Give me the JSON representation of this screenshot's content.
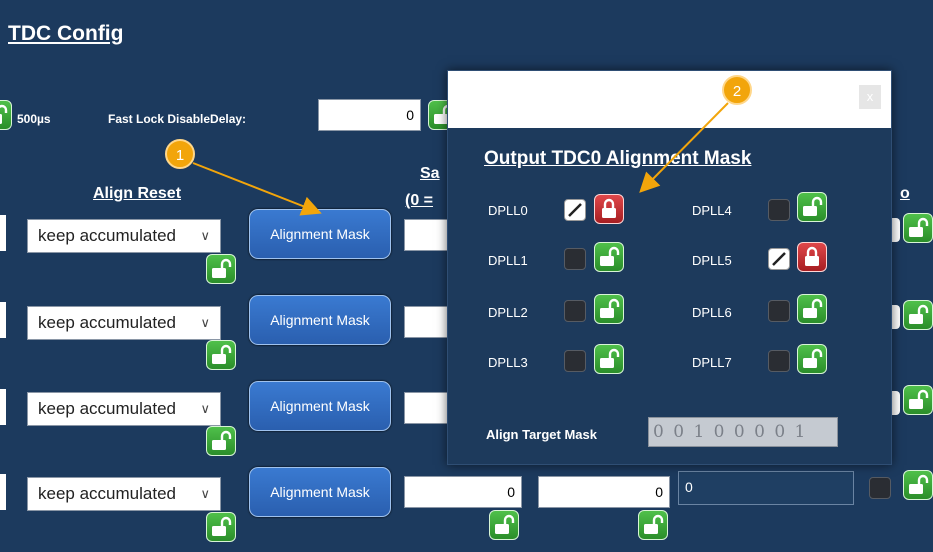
{
  "page": {
    "title": "TDC Config",
    "time_value": "500µs",
    "fast_lock_label": "Fast Lock DisableDelay:",
    "fast_lock_value": "0"
  },
  "columns": {
    "align_reset": "Align Reset",
    "sa_partial": "Sa",
    "sa_partial2": "(0 =",
    "right_partial": "o"
  },
  "rows": [
    {
      "mode": "keep accumulated",
      "button": "Alignment Mask"
    },
    {
      "mode": "keep accumulated",
      "button": "Alignment Mask"
    },
    {
      "mode": "keep accumulated",
      "button": "Alignment Mask"
    },
    {
      "mode": "keep accumulated",
      "button": "Alignment Mask",
      "val1": "0",
      "val2": "0",
      "val3": "0"
    }
  ],
  "modal": {
    "title": "Output TDC0 Alignment Mask",
    "close": "x",
    "dplls": [
      {
        "label": "DPLL0",
        "checked": true,
        "locked": true
      },
      {
        "label": "DPLL1",
        "checked": false,
        "locked": false
      },
      {
        "label": "DPLL2",
        "checked": false,
        "locked": false
      },
      {
        "label": "DPLL3",
        "checked": false,
        "locked": false
      },
      {
        "label": "DPLL4",
        "checked": false,
        "locked": false
      },
      {
        "label": "DPLL5",
        "checked": true,
        "locked": true
      },
      {
        "label": "DPLL6",
        "checked": false,
        "locked": false
      },
      {
        "label": "DPLL7",
        "checked": false,
        "locked": false
      }
    ],
    "target_label": "Align Target Mask",
    "target_value": "0 0 1 0 0 0 0 1"
  },
  "annotations": {
    "badge1": "1",
    "badge2": "2",
    "color": "#f2a50b"
  }
}
